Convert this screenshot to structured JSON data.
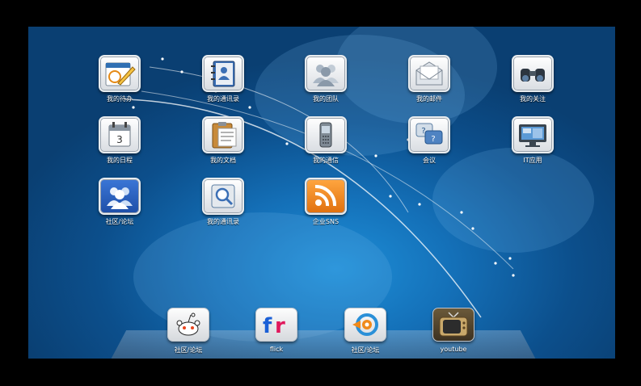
{
  "icons": [
    {
      "label": "我的待办"
    },
    {
      "label": "我的通讯录"
    },
    {
      "label": "我的团队"
    },
    {
      "label": "我的邮件"
    },
    {
      "label": "我的关注"
    },
    {
      "label": "我的日程"
    },
    {
      "label": "我的文档"
    },
    {
      "label": "我的通信"
    },
    {
      "label": "会议"
    },
    {
      "label": "IT应用"
    },
    {
      "label": "社区/论坛"
    },
    {
      "label": "我的通讯录"
    },
    {
      "label": "企业SNS"
    }
  ],
  "dock": [
    {
      "label": "社区/论坛"
    },
    {
      "label": "flick"
    },
    {
      "label": "社区/论坛"
    },
    {
      "label": "youtube"
    }
  ],
  "colors": {
    "background": "#0c4f8c",
    "accent": "#1e8fd8",
    "rss": "#f08a1c",
    "flick_blue": "#1a5fd6",
    "flick_red": "#e0185c"
  }
}
